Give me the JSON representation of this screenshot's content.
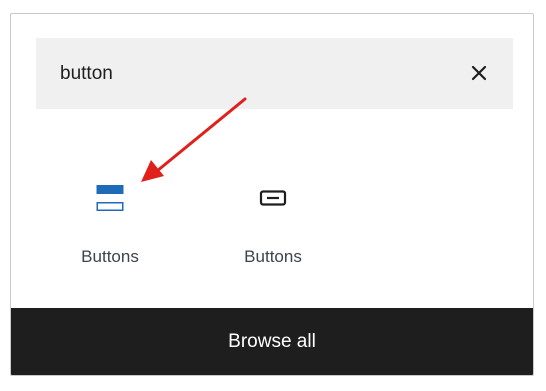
{
  "search": {
    "value": "button",
    "clear_icon": "close-icon"
  },
  "results": [
    {
      "label": "Buttons",
      "icon": "buttons-block-icon",
      "color": "#1e6bb8"
    },
    {
      "label": "Buttons",
      "icon": "button-block-icon",
      "color": "#1e1e1e"
    }
  ],
  "footer": {
    "label": "Browse all"
  },
  "annotation": {
    "icon": "red-arrow-icon",
    "color": "#e0201b"
  }
}
